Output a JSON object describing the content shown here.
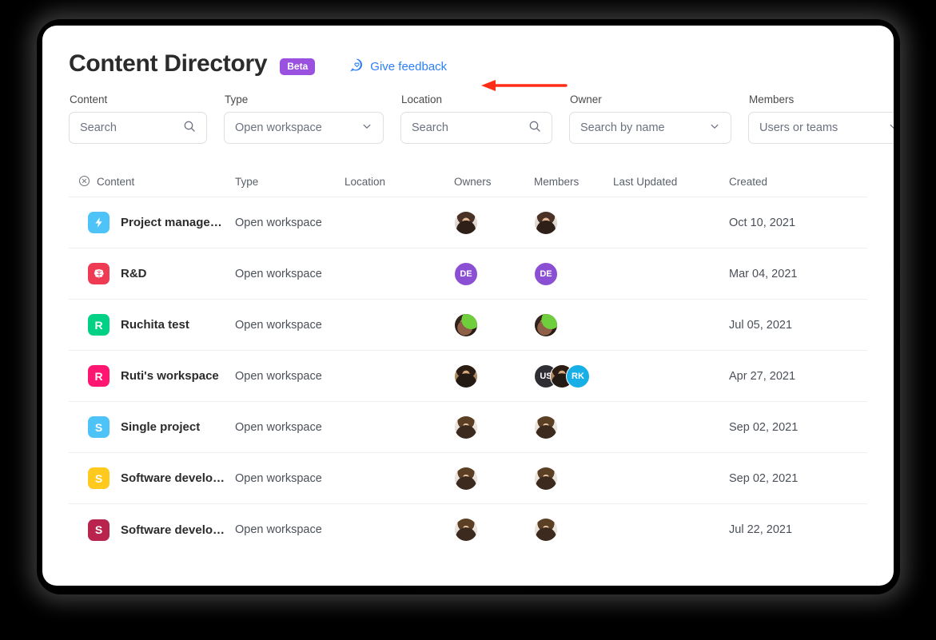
{
  "header": {
    "title": "Content Directory",
    "badge": "Beta",
    "feedback_label": "Give feedback",
    "feedback_icon": "speech-bubble-heart-icon",
    "badge_color": "#9B51E0",
    "link_color": "#2D7FF9",
    "annotation_arrow_color": "#FF2D16"
  },
  "filters": [
    {
      "label": "Content",
      "value": "Search",
      "control": "search",
      "width_class": "w-content"
    },
    {
      "label": "Type",
      "value": "Open workspace",
      "control": "select",
      "width_class": "w-type"
    },
    {
      "label": "Location",
      "value": "Search",
      "control": "search",
      "width_class": "w-location"
    },
    {
      "label": "Owner",
      "value": "Search by name",
      "control": "select",
      "width_class": "w-owner"
    },
    {
      "label": "Members",
      "value": "Users or teams",
      "control": "select",
      "width_class": "w-members"
    }
  ],
  "table": {
    "columns": {
      "content": "Content",
      "type": "Type",
      "location": "Location",
      "owners": "Owners",
      "members": "Members",
      "last_updated": "Last Updated",
      "created": "Created"
    },
    "content_header_icon": "circle-x-icon",
    "rows": [
      {
        "name": "Project manage…",
        "icon": {
          "kind": "glyph",
          "glyph": "lightning-bolt-icon",
          "color": "#4EC3F7"
        },
        "type": "Open workspace",
        "location": "",
        "owners": [
          {
            "kind": "photo",
            "style": "photo-a"
          }
        ],
        "members": [
          {
            "kind": "photo",
            "style": "photo-a"
          }
        ],
        "last_updated": "",
        "created": "Oct 10, 2021"
      },
      {
        "name": "R&D",
        "icon": {
          "kind": "glyph",
          "glyph": "brain-icon",
          "color": "#EE3A53"
        },
        "type": "Open workspace",
        "location": "",
        "owners": [
          {
            "kind": "initials",
            "text": "DE",
            "color": "#8B4FD4"
          }
        ],
        "members": [
          {
            "kind": "initials",
            "text": "DE",
            "color": "#8B4FD4"
          }
        ],
        "last_updated": "",
        "created": "Mar 04, 2021"
      },
      {
        "name": "Ruchita test",
        "icon": {
          "kind": "letter",
          "glyph": "R",
          "color": "#00D184"
        },
        "type": "Open workspace",
        "location": "",
        "owners": [
          {
            "kind": "photo",
            "style": "photo-green"
          }
        ],
        "members": [
          {
            "kind": "photo",
            "style": "photo-green"
          }
        ],
        "last_updated": "",
        "created": "Jul 05, 2021"
      },
      {
        "name": "Ruti's workspace",
        "icon": {
          "kind": "letter",
          "glyph": "R",
          "color": "#FF1670"
        },
        "type": "Open workspace",
        "location": "",
        "owners": [
          {
            "kind": "photo",
            "style": "photo-dark"
          }
        ],
        "members": [
          {
            "kind": "initials",
            "text": "US",
            "color": "#2E2E33"
          },
          {
            "kind": "photo",
            "style": "photo-dark"
          },
          {
            "kind": "initials",
            "text": "RK",
            "color": "#18AEE6"
          }
        ],
        "last_updated": "",
        "created": "Apr 27, 2021"
      },
      {
        "name": "Single project",
        "icon": {
          "kind": "letter",
          "glyph": "S",
          "color": "#4EC3F7"
        },
        "type": "Open workspace",
        "location": "",
        "owners": [
          {
            "kind": "photo",
            "style": "photo-tall"
          }
        ],
        "members": [
          {
            "kind": "photo",
            "style": "photo-tall"
          }
        ],
        "last_updated": "",
        "created": "Sep 02, 2021"
      },
      {
        "name": "Software develo…",
        "icon": {
          "kind": "letter",
          "glyph": "S",
          "color": "#FFC91E"
        },
        "type": "Open workspace",
        "location": "",
        "owners": [
          {
            "kind": "photo",
            "style": "photo-tall"
          }
        ],
        "members": [
          {
            "kind": "photo",
            "style": "photo-tall"
          }
        ],
        "last_updated": "",
        "created": "Sep 02, 2021"
      },
      {
        "name": "Software develo…",
        "icon": {
          "kind": "letter",
          "glyph": "S",
          "color": "#B8244E"
        },
        "type": "Open workspace",
        "location": "",
        "owners": [
          {
            "kind": "photo",
            "style": "photo-tall"
          }
        ],
        "members": [
          {
            "kind": "photo",
            "style": "photo-tall"
          }
        ],
        "last_updated": "",
        "created": "Jul 22, 2021"
      }
    ]
  }
}
